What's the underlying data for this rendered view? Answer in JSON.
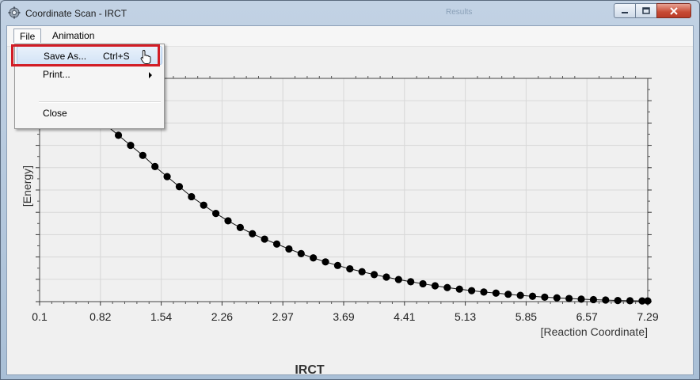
{
  "window": {
    "title": "Coordinate Scan - IRCT",
    "ghost_title": "Results"
  },
  "menu": {
    "file": "File",
    "animation": "Animation"
  },
  "file_menu": {
    "save_as": "Save As...",
    "save_as_shortcut": "Ctrl+S",
    "print": "Print...",
    "close": "Close"
  },
  "colors": {
    "highlight_border": "#d21c25",
    "data_point": "#000000",
    "grid": "#d7d7d7"
  },
  "chart_data": {
    "type": "scatter",
    "title": "IRCT",
    "xlabel": "[Reaction Coordinate]",
    "ylabel": "[Energy]",
    "x_ticks": [
      "0.1",
      "0.82",
      "1.54",
      "2.26",
      "2.97",
      "3.69",
      "4.41",
      "5.13",
      "5.85",
      "6.57",
      "7.29"
    ],
    "xlim": [
      0.1,
      7.29
    ],
    "ylim": [
      0.0,
      1.0
    ],
    "grid": true,
    "y_tick_labels_shown": false,
    "series": [
      {
        "marker": "circle",
        "line": true,
        "x": [
          0.6,
          0.744,
          0.888,
          1.032,
          1.176,
          1.32,
          1.464,
          1.608,
          1.752,
          1.896,
          2.04,
          2.184,
          2.328,
          2.472,
          2.616,
          2.76,
          2.904,
          3.048,
          3.192,
          3.336,
          3.48,
          3.624,
          3.768,
          3.912,
          4.056,
          4.2,
          4.344,
          4.488,
          4.632,
          4.776,
          4.92,
          5.064,
          5.208,
          5.352,
          5.496,
          5.64,
          5.784,
          5.928,
          6.072,
          6.216,
          6.36,
          6.504,
          6.648,
          6.792,
          6.936,
          7.08,
          7.224,
          7.29
        ],
        "y": [
          0.87,
          0.82,
          0.79,
          0.745,
          0.7,
          0.655,
          0.605,
          0.56,
          0.515,
          0.47,
          0.432,
          0.395,
          0.362,
          0.332,
          0.304,
          0.28,
          0.258,
          0.236,
          0.215,
          0.196,
          0.178,
          0.162,
          0.147,
          0.134,
          0.121,
          0.11,
          0.099,
          0.089,
          0.08,
          0.071,
          0.063,
          0.056,
          0.049,
          0.043,
          0.038,
          0.033,
          0.028,
          0.024,
          0.02,
          0.017,
          0.014,
          0.011,
          0.009,
          0.007,
          0.005,
          0.004,
          0.003,
          0.003
        ]
      }
    ]
  }
}
